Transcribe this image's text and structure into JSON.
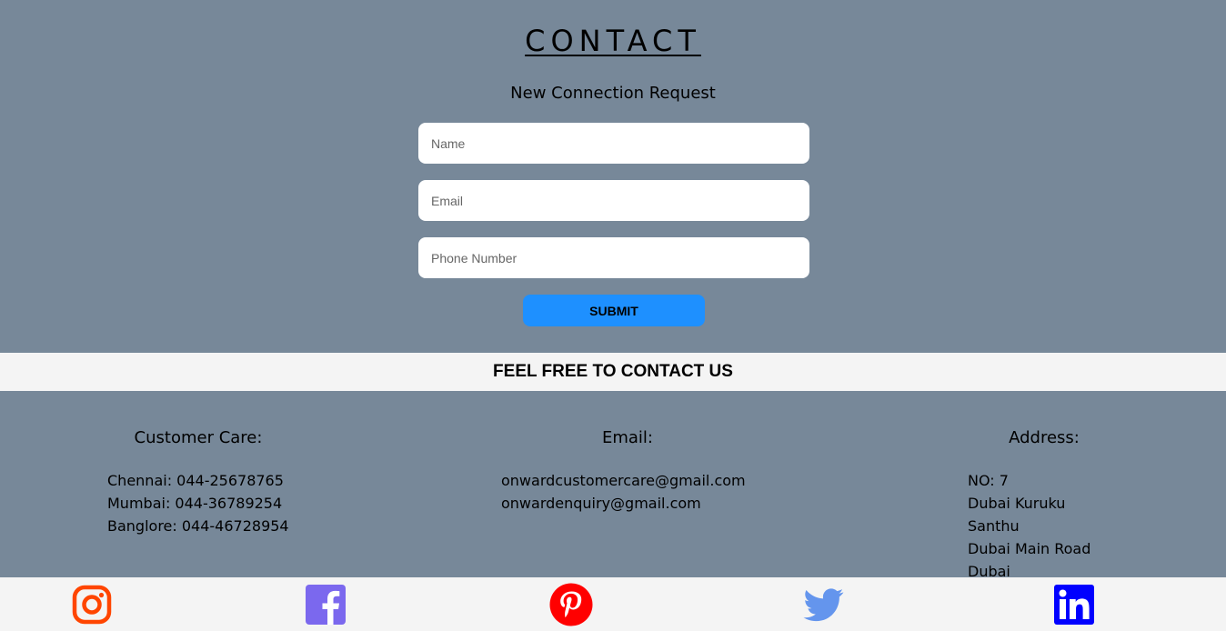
{
  "contact": {
    "title": "CONTACT",
    "subtitle": "New Connection Request",
    "fields": {
      "name_placeholder": "Name",
      "email_placeholder": "Email",
      "phone_placeholder": "Phone Number"
    },
    "submit_label": "SUBMIT"
  },
  "banner": {
    "text": "FEEL FREE TO CONTACT US"
  },
  "info": {
    "customer_care": {
      "heading": "Customer Care:",
      "lines": [
        "Chennai: 044-25678765",
        "Mumbai: 044-36789254",
        "Banglore: 044-46728954"
      ]
    },
    "email": {
      "heading": "Email:",
      "lines": [
        "onwardcustomercare@gmail.com",
        "onwardenquiry@gmail.com"
      ]
    },
    "address": {
      "heading": "Address:",
      "lines": [
        "NO: 7",
        "Dubai Kuruku Santhu",
        "Dubai Main Road",
        "Dubai"
      ]
    }
  },
  "social": {
    "icons": [
      "instagram-icon",
      "facebook-icon",
      "pinterest-icon",
      "twitter-icon",
      "linkedin-icon"
    ],
    "colors": {
      "instagram": "#ff4500",
      "facebook": "#7b68ee",
      "pinterest": "#ff0000",
      "twitter": "#6495ed",
      "linkedin": "#0000ff"
    }
  },
  "theme": {
    "background": "#778899",
    "band": "#f4f4f4",
    "accent": "#1e90ff"
  }
}
